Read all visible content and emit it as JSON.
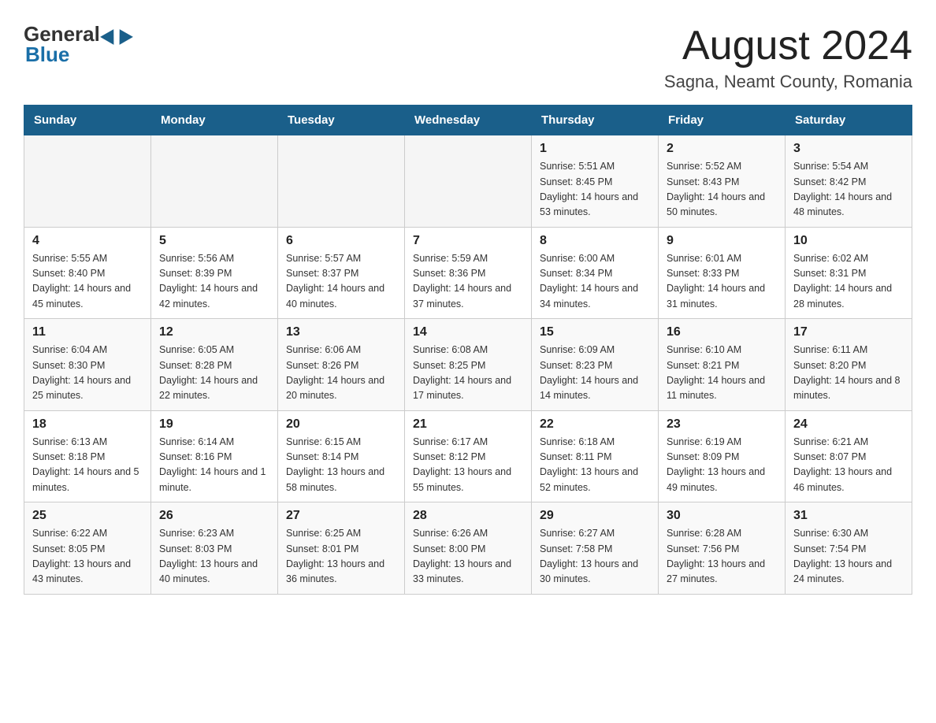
{
  "header": {
    "logo_general": "General",
    "logo_blue": "Blue",
    "title": "August 2024",
    "subtitle": "Sagna, Neamt County, Romania"
  },
  "calendar": {
    "days_of_week": [
      "Sunday",
      "Monday",
      "Tuesday",
      "Wednesday",
      "Thursday",
      "Friday",
      "Saturday"
    ],
    "weeks": [
      [
        {
          "day": "",
          "info": ""
        },
        {
          "day": "",
          "info": ""
        },
        {
          "day": "",
          "info": ""
        },
        {
          "day": "",
          "info": ""
        },
        {
          "day": "1",
          "info": "Sunrise: 5:51 AM\nSunset: 8:45 PM\nDaylight: 14 hours and 53 minutes."
        },
        {
          "day": "2",
          "info": "Sunrise: 5:52 AM\nSunset: 8:43 PM\nDaylight: 14 hours and 50 minutes."
        },
        {
          "day": "3",
          "info": "Sunrise: 5:54 AM\nSunset: 8:42 PM\nDaylight: 14 hours and 48 minutes."
        }
      ],
      [
        {
          "day": "4",
          "info": "Sunrise: 5:55 AM\nSunset: 8:40 PM\nDaylight: 14 hours and 45 minutes."
        },
        {
          "day": "5",
          "info": "Sunrise: 5:56 AM\nSunset: 8:39 PM\nDaylight: 14 hours and 42 minutes."
        },
        {
          "day": "6",
          "info": "Sunrise: 5:57 AM\nSunset: 8:37 PM\nDaylight: 14 hours and 40 minutes."
        },
        {
          "day": "7",
          "info": "Sunrise: 5:59 AM\nSunset: 8:36 PM\nDaylight: 14 hours and 37 minutes."
        },
        {
          "day": "8",
          "info": "Sunrise: 6:00 AM\nSunset: 8:34 PM\nDaylight: 14 hours and 34 minutes."
        },
        {
          "day": "9",
          "info": "Sunrise: 6:01 AM\nSunset: 8:33 PM\nDaylight: 14 hours and 31 minutes."
        },
        {
          "day": "10",
          "info": "Sunrise: 6:02 AM\nSunset: 8:31 PM\nDaylight: 14 hours and 28 minutes."
        }
      ],
      [
        {
          "day": "11",
          "info": "Sunrise: 6:04 AM\nSunset: 8:30 PM\nDaylight: 14 hours and 25 minutes."
        },
        {
          "day": "12",
          "info": "Sunrise: 6:05 AM\nSunset: 8:28 PM\nDaylight: 14 hours and 22 minutes."
        },
        {
          "day": "13",
          "info": "Sunrise: 6:06 AM\nSunset: 8:26 PM\nDaylight: 14 hours and 20 minutes."
        },
        {
          "day": "14",
          "info": "Sunrise: 6:08 AM\nSunset: 8:25 PM\nDaylight: 14 hours and 17 minutes."
        },
        {
          "day": "15",
          "info": "Sunrise: 6:09 AM\nSunset: 8:23 PM\nDaylight: 14 hours and 14 minutes."
        },
        {
          "day": "16",
          "info": "Sunrise: 6:10 AM\nSunset: 8:21 PM\nDaylight: 14 hours and 11 minutes."
        },
        {
          "day": "17",
          "info": "Sunrise: 6:11 AM\nSunset: 8:20 PM\nDaylight: 14 hours and 8 minutes."
        }
      ],
      [
        {
          "day": "18",
          "info": "Sunrise: 6:13 AM\nSunset: 8:18 PM\nDaylight: 14 hours and 5 minutes."
        },
        {
          "day": "19",
          "info": "Sunrise: 6:14 AM\nSunset: 8:16 PM\nDaylight: 14 hours and 1 minute."
        },
        {
          "day": "20",
          "info": "Sunrise: 6:15 AM\nSunset: 8:14 PM\nDaylight: 13 hours and 58 minutes."
        },
        {
          "day": "21",
          "info": "Sunrise: 6:17 AM\nSunset: 8:12 PM\nDaylight: 13 hours and 55 minutes."
        },
        {
          "day": "22",
          "info": "Sunrise: 6:18 AM\nSunset: 8:11 PM\nDaylight: 13 hours and 52 minutes."
        },
        {
          "day": "23",
          "info": "Sunrise: 6:19 AM\nSunset: 8:09 PM\nDaylight: 13 hours and 49 minutes."
        },
        {
          "day": "24",
          "info": "Sunrise: 6:21 AM\nSunset: 8:07 PM\nDaylight: 13 hours and 46 minutes."
        }
      ],
      [
        {
          "day": "25",
          "info": "Sunrise: 6:22 AM\nSunset: 8:05 PM\nDaylight: 13 hours and 43 minutes."
        },
        {
          "day": "26",
          "info": "Sunrise: 6:23 AM\nSunset: 8:03 PM\nDaylight: 13 hours and 40 minutes."
        },
        {
          "day": "27",
          "info": "Sunrise: 6:25 AM\nSunset: 8:01 PM\nDaylight: 13 hours and 36 minutes."
        },
        {
          "day": "28",
          "info": "Sunrise: 6:26 AM\nSunset: 8:00 PM\nDaylight: 13 hours and 33 minutes."
        },
        {
          "day": "29",
          "info": "Sunrise: 6:27 AM\nSunset: 7:58 PM\nDaylight: 13 hours and 30 minutes."
        },
        {
          "day": "30",
          "info": "Sunrise: 6:28 AM\nSunset: 7:56 PM\nDaylight: 13 hours and 27 minutes."
        },
        {
          "day": "31",
          "info": "Sunrise: 6:30 AM\nSunset: 7:54 PM\nDaylight: 13 hours and 24 minutes."
        }
      ]
    ]
  }
}
